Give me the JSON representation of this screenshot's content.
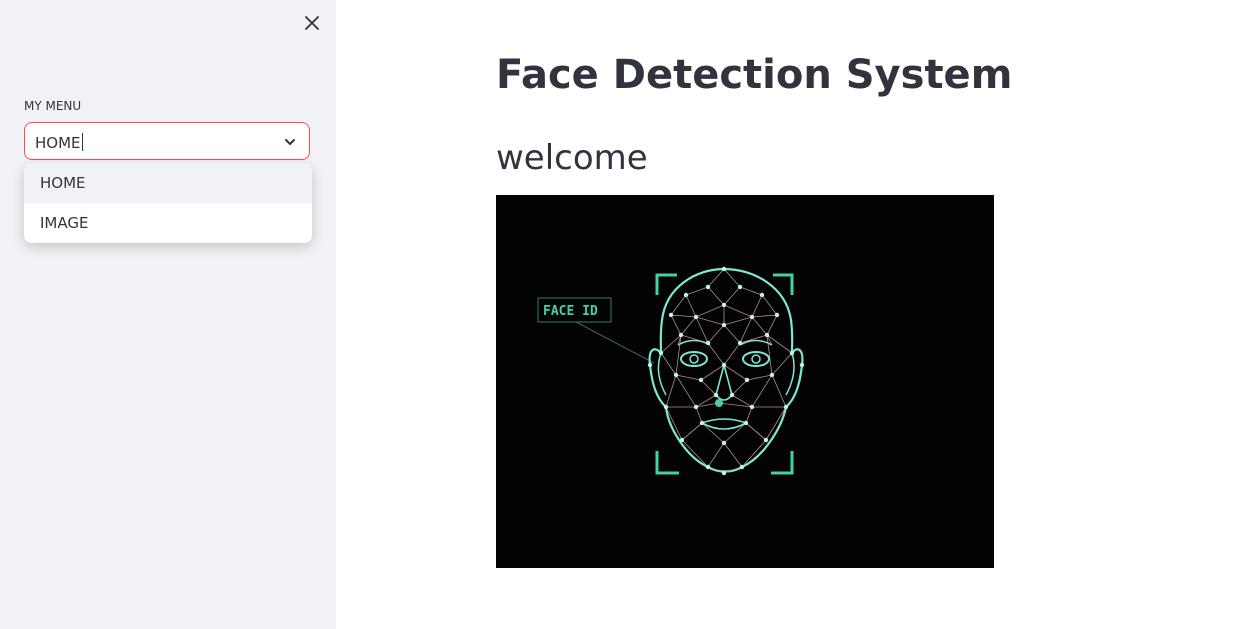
{
  "sidebar": {
    "menu_label": "MY MENU",
    "select": {
      "value": "HOME",
      "options": [
        "HOME",
        "IMAGE"
      ]
    }
  },
  "main": {
    "title": "Face Detection System",
    "subtitle": "welcome",
    "image": {
      "tag_text": "FACE ID"
    }
  },
  "colors": {
    "sidebar_bg": "#f0f2f6",
    "accent": "#ff4b4b",
    "text": "#31333f",
    "mesh": "#7fe6cf"
  }
}
